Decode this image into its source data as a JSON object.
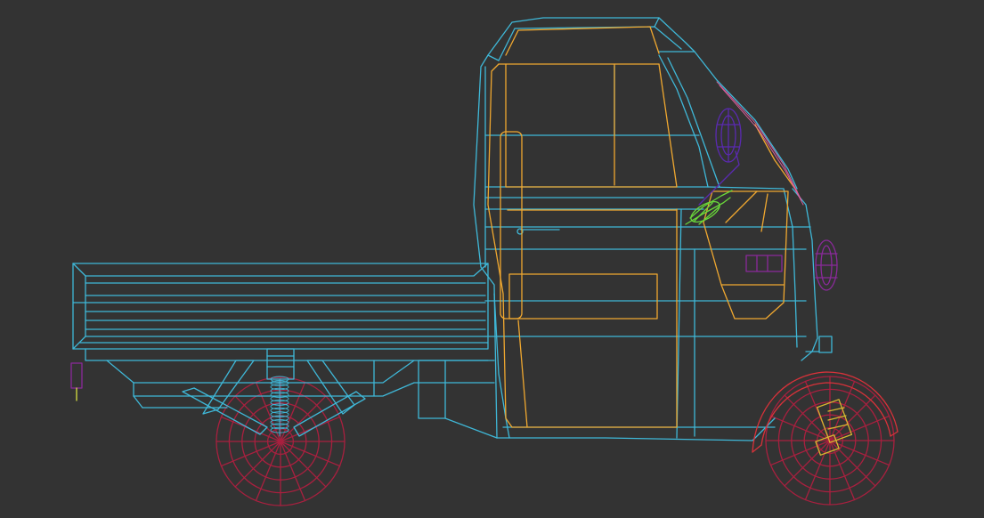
{
  "viewport": {
    "background": "#333333",
    "view_type": "3D wireframe side view"
  },
  "colors": {
    "body": "#3fb8d8",
    "cabin_inner": "#f0a830",
    "wheels": "#a8203f",
    "mirror": "#5a2ab0",
    "headlight": "#8a2a9a",
    "handlebar": "#6ad83a",
    "fender": "#d8323a",
    "hub": "#d8b830",
    "trim_pink": "#e060a0"
  },
  "objects": [
    {
      "name": "cargo-bed"
    },
    {
      "name": "cabin"
    },
    {
      "name": "door"
    },
    {
      "name": "rear-wheel"
    },
    {
      "name": "front-wheel"
    },
    {
      "name": "rear-suspension"
    },
    {
      "name": "side-mirror"
    },
    {
      "name": "headlight"
    },
    {
      "name": "handlebar"
    },
    {
      "name": "tail-light"
    }
  ]
}
